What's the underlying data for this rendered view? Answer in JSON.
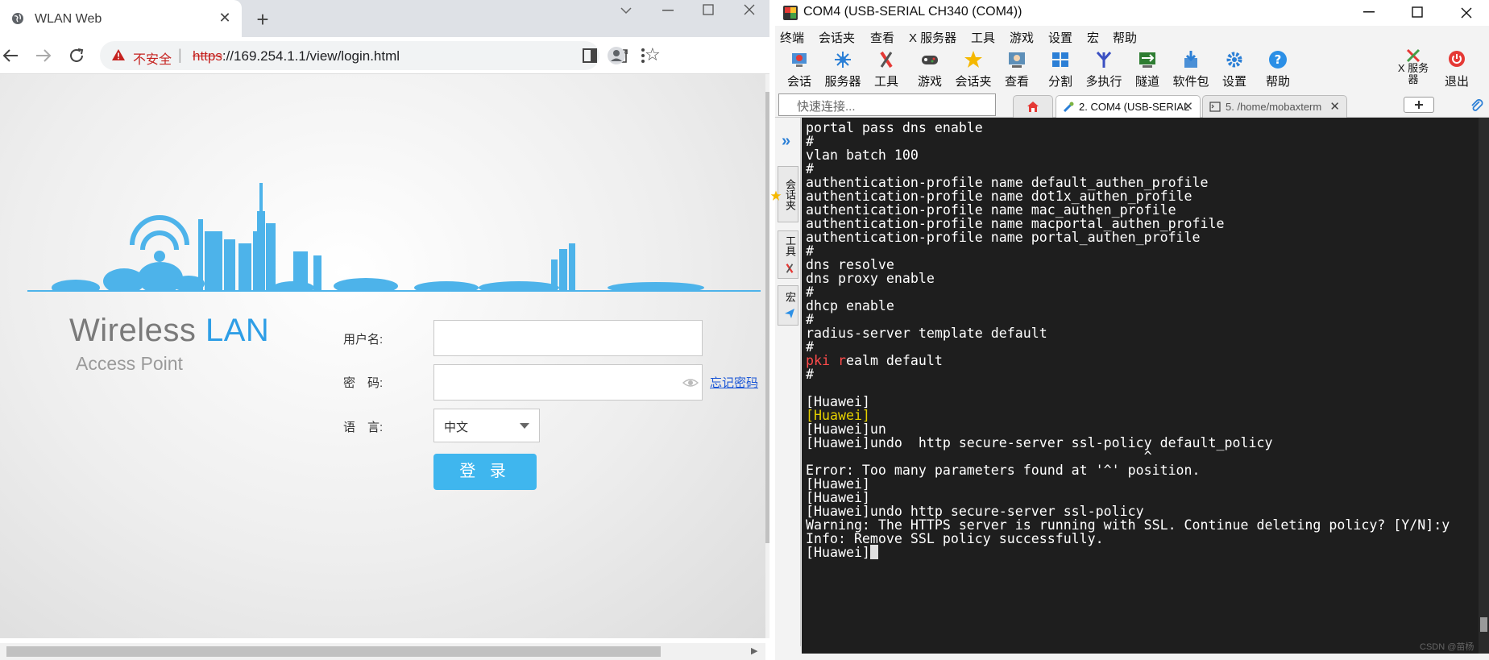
{
  "browser": {
    "tab_title": "WLAN Web",
    "tab_close": "✕",
    "new_tab": "+",
    "insecure_label": "不安全",
    "separator": "|",
    "url_scheme": "https",
    "url_rest": "://169.254.1.1/view/login.html"
  },
  "login": {
    "brand_word1": "Wireless ",
    "brand_word2": "LAN",
    "brand_sub": "Access Point",
    "username_label": "用户名:",
    "password_label": "密　码:",
    "language_label": "语　言:",
    "username_value": "",
    "password_value": "",
    "forgot_password": "忘记密码",
    "language_selected": "中文",
    "login_button": "登 录"
  },
  "moba": {
    "title": "COM4  (USB-SERIAL CH340 (COM4))",
    "menu": [
      "终端",
      "会话夹",
      "查看",
      "X 服务器",
      "工具",
      "游戏",
      "设置",
      "宏",
      "帮助"
    ],
    "toolbar": [
      {
        "label": "会话",
        "icon": "session-icon"
      },
      {
        "label": "服务器",
        "icon": "servers-icon"
      },
      {
        "label": "工具",
        "icon": "tools-icon"
      },
      {
        "label": "游戏",
        "icon": "games-icon"
      },
      {
        "label": "会话夹",
        "icon": "star-icon"
      },
      {
        "label": "查看",
        "icon": "view-icon"
      },
      {
        "label": "分割",
        "icon": "split-icon"
      },
      {
        "label": "多执行",
        "icon": "multiexec-icon"
      },
      {
        "label": "隧道",
        "icon": "tunnel-icon"
      },
      {
        "label": "软件包",
        "icon": "packages-icon"
      },
      {
        "label": "设置",
        "icon": "settings-icon"
      },
      {
        "label": "帮助",
        "icon": "help-icon"
      }
    ],
    "xserver_label_1": "X 服务",
    "xserver_label_2": "器",
    "exit_label": "退出",
    "quick_connect_placeholder": "快速连接...",
    "tabs": [
      {
        "label": "2. COM4  (USB-SERIAL",
        "close": "✕",
        "icon": "serial-icon"
      },
      {
        "label": "5. /home/mobaxterm",
        "close": "✕",
        "icon": "terminal-icon"
      }
    ],
    "side_tabs": [
      "会话夹",
      "工具",
      "宏"
    ],
    "colors": {
      "error": "#ff4b4b",
      "yellow": "#e5d000",
      "accent": "#2b7fd6"
    },
    "watermark": "CSDN @苗杨"
  },
  "terminal": {
    "lines": [
      {
        "text": "portal pass dns enable"
      },
      {
        "text": "#"
      },
      {
        "text": "vlan batch 100"
      },
      {
        "text": "#"
      },
      {
        "text": "authentication-profile name default_authen_profile"
      },
      {
        "text": "authentication-profile name dot1x_authen_profile"
      },
      {
        "text": "authentication-profile name mac_authen_profile"
      },
      {
        "text": "authentication-profile name macportal_authen_profile"
      },
      {
        "text": "authentication-profile name portal_authen_profile"
      },
      {
        "text": "#"
      },
      {
        "text": "dns resolve"
      },
      {
        "text": "dns proxy enable"
      },
      {
        "text": "#"
      },
      {
        "text": "dhcp enable"
      },
      {
        "text": "#"
      },
      {
        "text": "radius-server template default"
      },
      {
        "text": "#"
      },
      {
        "segments": [
          {
            "t": "pki",
            "c": "red"
          },
          {
            "t": " "
          },
          {
            "t": "r",
            "c": "red"
          },
          {
            "t": "ealm default"
          }
        ]
      },
      {
        "text": "#"
      },
      {
        "text": ""
      },
      {
        "text": "[Huawei]"
      },
      {
        "text": "[Huawei]",
        "color": "yellow"
      },
      {
        "text": "[Huawei]un"
      },
      {
        "text": "[Huawei]undo  http secure-server ssl-policy default_policy"
      },
      {
        "text": "                                          ^"
      },
      {
        "text": "Error: Too many parameters found at '^' position."
      },
      {
        "text": "[Huawei]"
      },
      {
        "text": "[Huawei]"
      },
      {
        "text": "[Huawei]undo http secure-server ssl-policy"
      },
      {
        "text": "Warning: The HTTPS server is running with SSL. Continue deleting policy? [Y/N]:y"
      },
      {
        "text": "Info: Remove SSL policy successfully."
      },
      {
        "text": "[Huawei]",
        "cursor": true
      }
    ]
  }
}
